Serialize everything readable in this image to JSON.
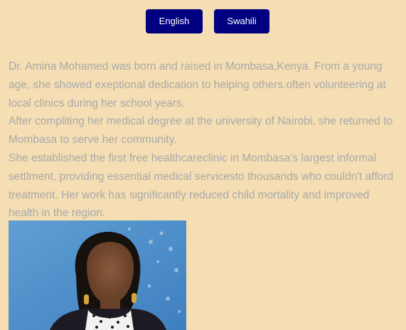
{
  "language_buttons": {
    "english_label": "English",
    "swahili_label": "Swahili"
  },
  "bio": {
    "lines": [
      "Dr. Amina Mohamed was born and raised in Mombasa,Kenya. From a young",
      "age, she showed exeptional dedication to helping others.often volunteering at",
      "local clinics during her school years.",
      "After compliting her medical degree at the university of Nairobi, she returned to",
      "Mombasa to serve her community.",
      "She established the first free healthcareclinic in Mombasa's largest informal",
      "settlment, providing essential medical servicesto thousands who couldn't afford",
      "treatment. Her work has significantly reduced child mortality and improved",
      "health in the region."
    ]
  },
  "colors": {
    "page_background": "#f5deb3",
    "button_background": "#000080",
    "button_text": "#ffffff",
    "body_text": "#a9a9a9"
  }
}
